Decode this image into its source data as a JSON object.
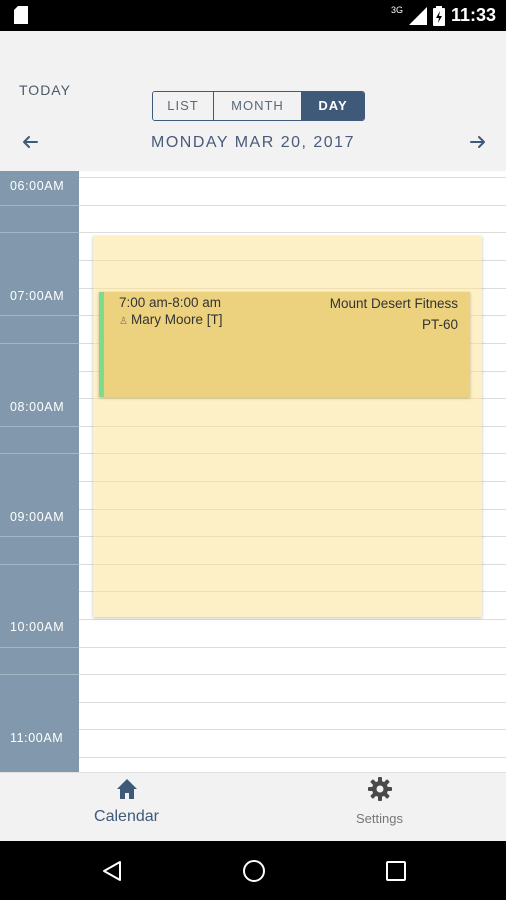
{
  "status_bar": {
    "network": "3G",
    "time": "11:33"
  },
  "header": {
    "today_label": "TODAY",
    "view_tabs": [
      {
        "label": "LIST",
        "active": false
      },
      {
        "label": "MONTH",
        "active": false
      },
      {
        "label": "DAY",
        "active": true
      }
    ],
    "date_title": "MONDAY MAR 20, 2017",
    "prev_icon": "arrow-left-icon",
    "next_icon": "arrow-right-icon"
  },
  "times": [
    "06:00AM",
    "07:00AM",
    "08:00AM",
    "09:00AM",
    "10:00AM",
    "11:00AM"
  ],
  "event": {
    "time": "7:00 am-8:00 am",
    "name": "Mary Moore [T]",
    "location": "Mount Desert Fitness",
    "code": "PT-60"
  },
  "bottom_nav": [
    {
      "label": "Calendar",
      "icon": "home-icon",
      "active": true
    },
    {
      "label": "Settings",
      "icon": "gear-icon",
      "active": false
    }
  ],
  "colors": {
    "accent": "#3f5a78",
    "time_column": "#8299ad",
    "availability": "#fdf0c7",
    "event": "#ecd27e",
    "event_bar": "#7ddc8a"
  }
}
